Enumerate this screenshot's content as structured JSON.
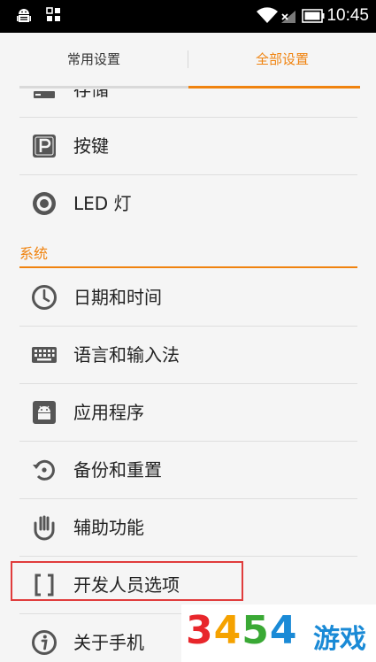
{
  "status_bar": {
    "time": "10:45",
    "icons": [
      "android-debug-icon",
      "grid-icon",
      "wifi-icon",
      "no-signal-icon",
      "battery-icon"
    ]
  },
  "tabs": [
    {
      "label": "常用设置",
      "active": false
    },
    {
      "label": "全部设置",
      "active": true
    }
  ],
  "items": [
    {
      "label": "存储",
      "icon": "storage-icon"
    },
    {
      "label": "按键",
      "icon": "button-key-icon"
    },
    {
      "label": "LED 灯",
      "icon": "led-icon"
    }
  ],
  "section": {
    "title": "系统"
  },
  "system_items": [
    {
      "label": "日期和时间",
      "icon": "clock-icon"
    },
    {
      "label": "语言和输入法",
      "icon": "keyboard-icon"
    },
    {
      "label": "应用程序",
      "icon": "android-app-icon"
    },
    {
      "label": "备份和重置",
      "icon": "backup-restore-icon"
    },
    {
      "label": "辅助功能",
      "icon": "hand-icon"
    },
    {
      "label": "开发人员选项",
      "icon": "brackets-icon"
    },
    {
      "label": "关于手机",
      "icon": "info-icon"
    }
  ],
  "colors": {
    "accent": "#f0830f",
    "highlight": "#e03c3c",
    "watermark_text": "#1a8ad6"
  },
  "watermark": {
    "digits": [
      "3",
      "4",
      "5",
      "4"
    ],
    "digit_colors": [
      "#e8262b",
      "#f5a200",
      "#3aa935",
      "#1a8ad6"
    ],
    "text": "游戏"
  }
}
